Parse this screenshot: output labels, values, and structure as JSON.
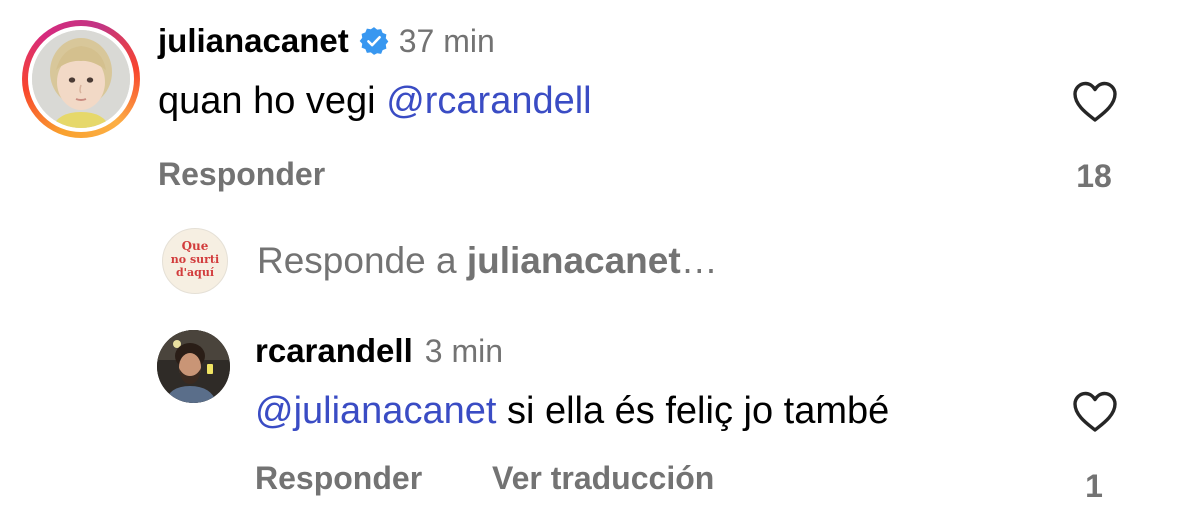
{
  "comments": [
    {
      "username": "julianacanet",
      "verified": true,
      "time": "37 min",
      "text_prefix": "quan ho vegi ",
      "mention": "@rcarandell",
      "text_suffix": "",
      "actions": {
        "reply": "Responder"
      },
      "likes": "18",
      "avatar_icon": "profile-photo-girl",
      "story_ring": true
    },
    {
      "username": "rcarandell",
      "verified": false,
      "time": "3 min",
      "text_prefix": "",
      "mention": "@julianacanet",
      "text_suffix": " si ella és feliç jo també",
      "actions": {
        "reply": "Responder",
        "translate": "Ver traducción"
      },
      "likes": "1",
      "avatar_icon": "profile-photo-man"
    }
  ],
  "composer": {
    "prefix": "Responde a ",
    "target": "julianacanet",
    "suffix": "…",
    "avatar_logo_text": [
      "Que",
      "no surti",
      "d'aquí"
    ]
  },
  "colors": {
    "mention": "#3a4cc4",
    "secondary_text": "#737373",
    "verified": "#3897f0"
  }
}
